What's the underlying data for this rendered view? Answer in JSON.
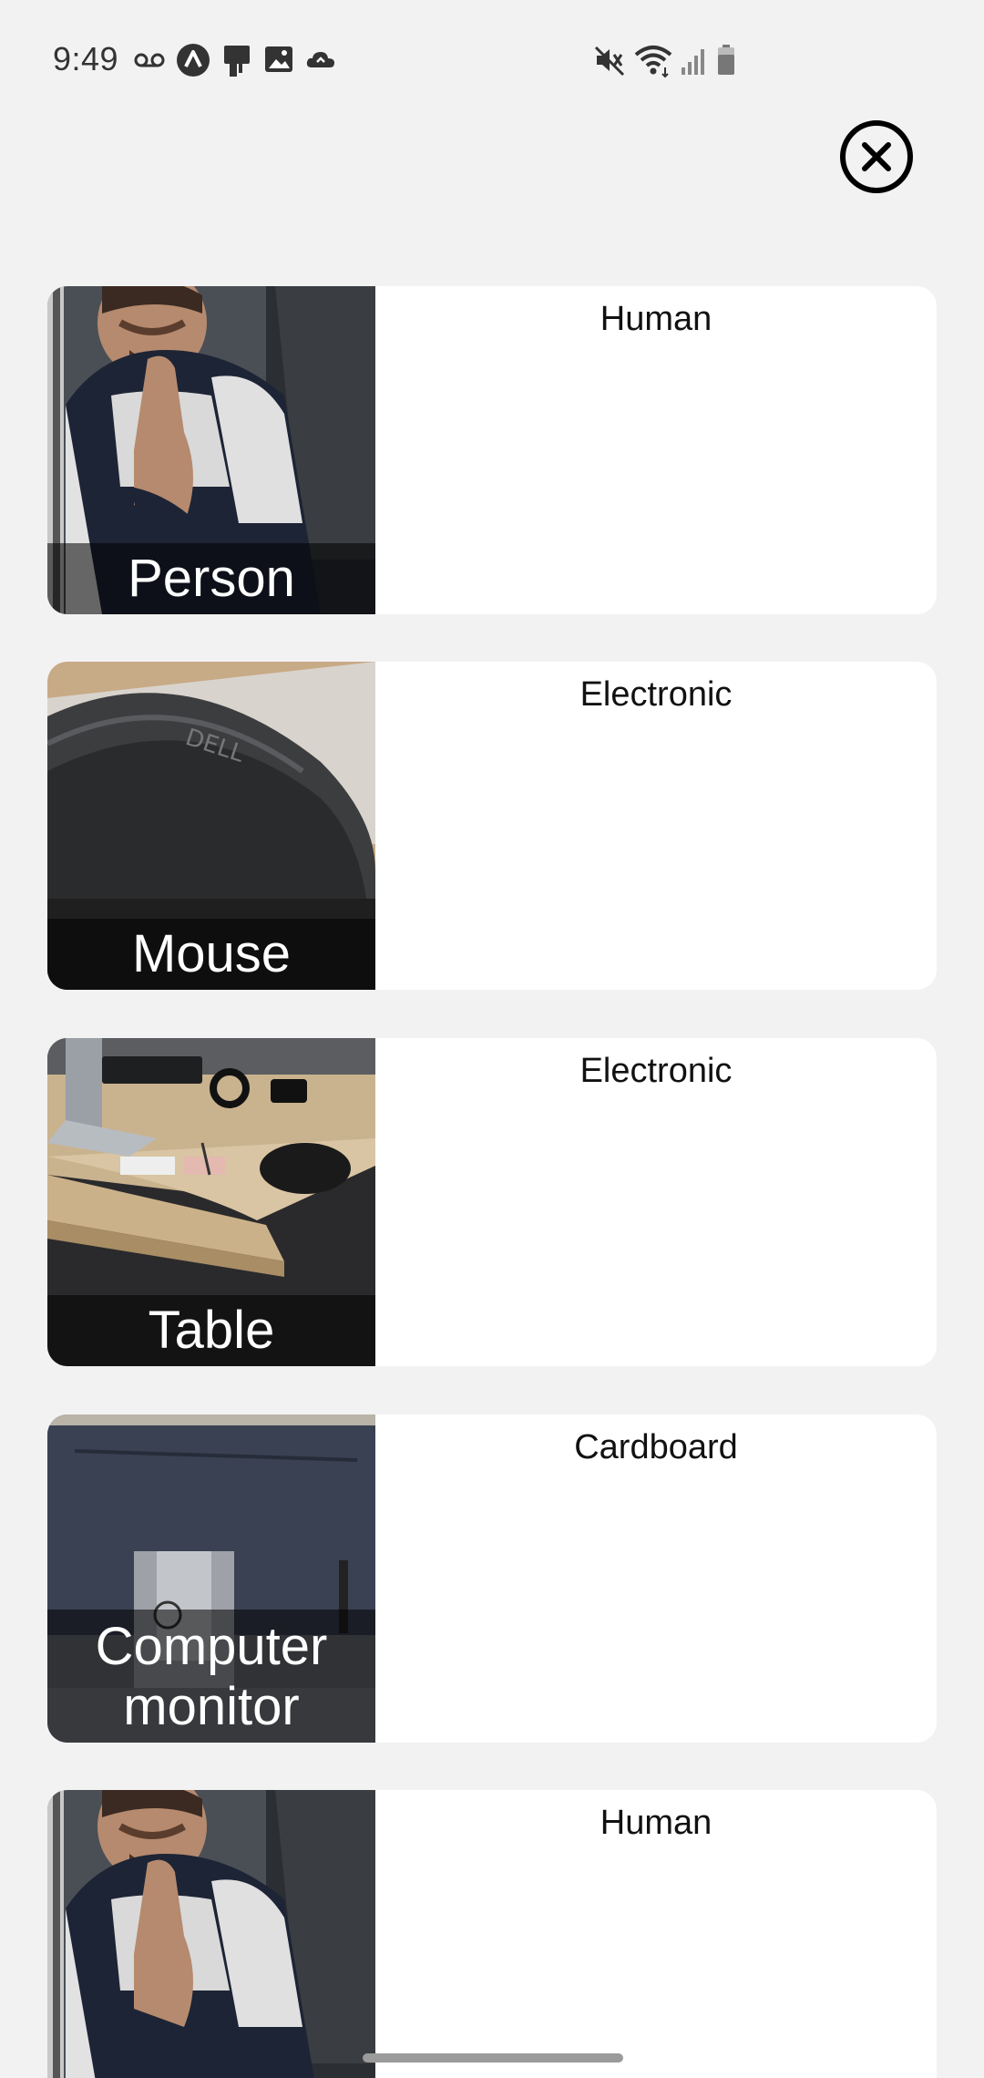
{
  "status_bar": {
    "time": "9:49",
    "icons_left": [
      "voicemail-icon",
      "navigation-app-icon",
      "cast-device-icon",
      "image-icon",
      "cloud-icon"
    ],
    "icons_right": [
      "mute-icon",
      "wifi-icon",
      "signal-icon",
      "battery-icon"
    ]
  },
  "close_button": {
    "icon": "close-circle-icon"
  },
  "results": [
    {
      "label": "Person",
      "category": "Human",
      "image": "person"
    },
    {
      "label": "Mouse",
      "category": "Electronic",
      "image": "mouse"
    },
    {
      "label": "Table",
      "category": "Electronic",
      "image": "desk"
    },
    {
      "label": "Computer monitor",
      "category": "Cardboard",
      "image": "monitor"
    },
    {
      "label": "",
      "category": "Human",
      "image": "person"
    }
  ]
}
